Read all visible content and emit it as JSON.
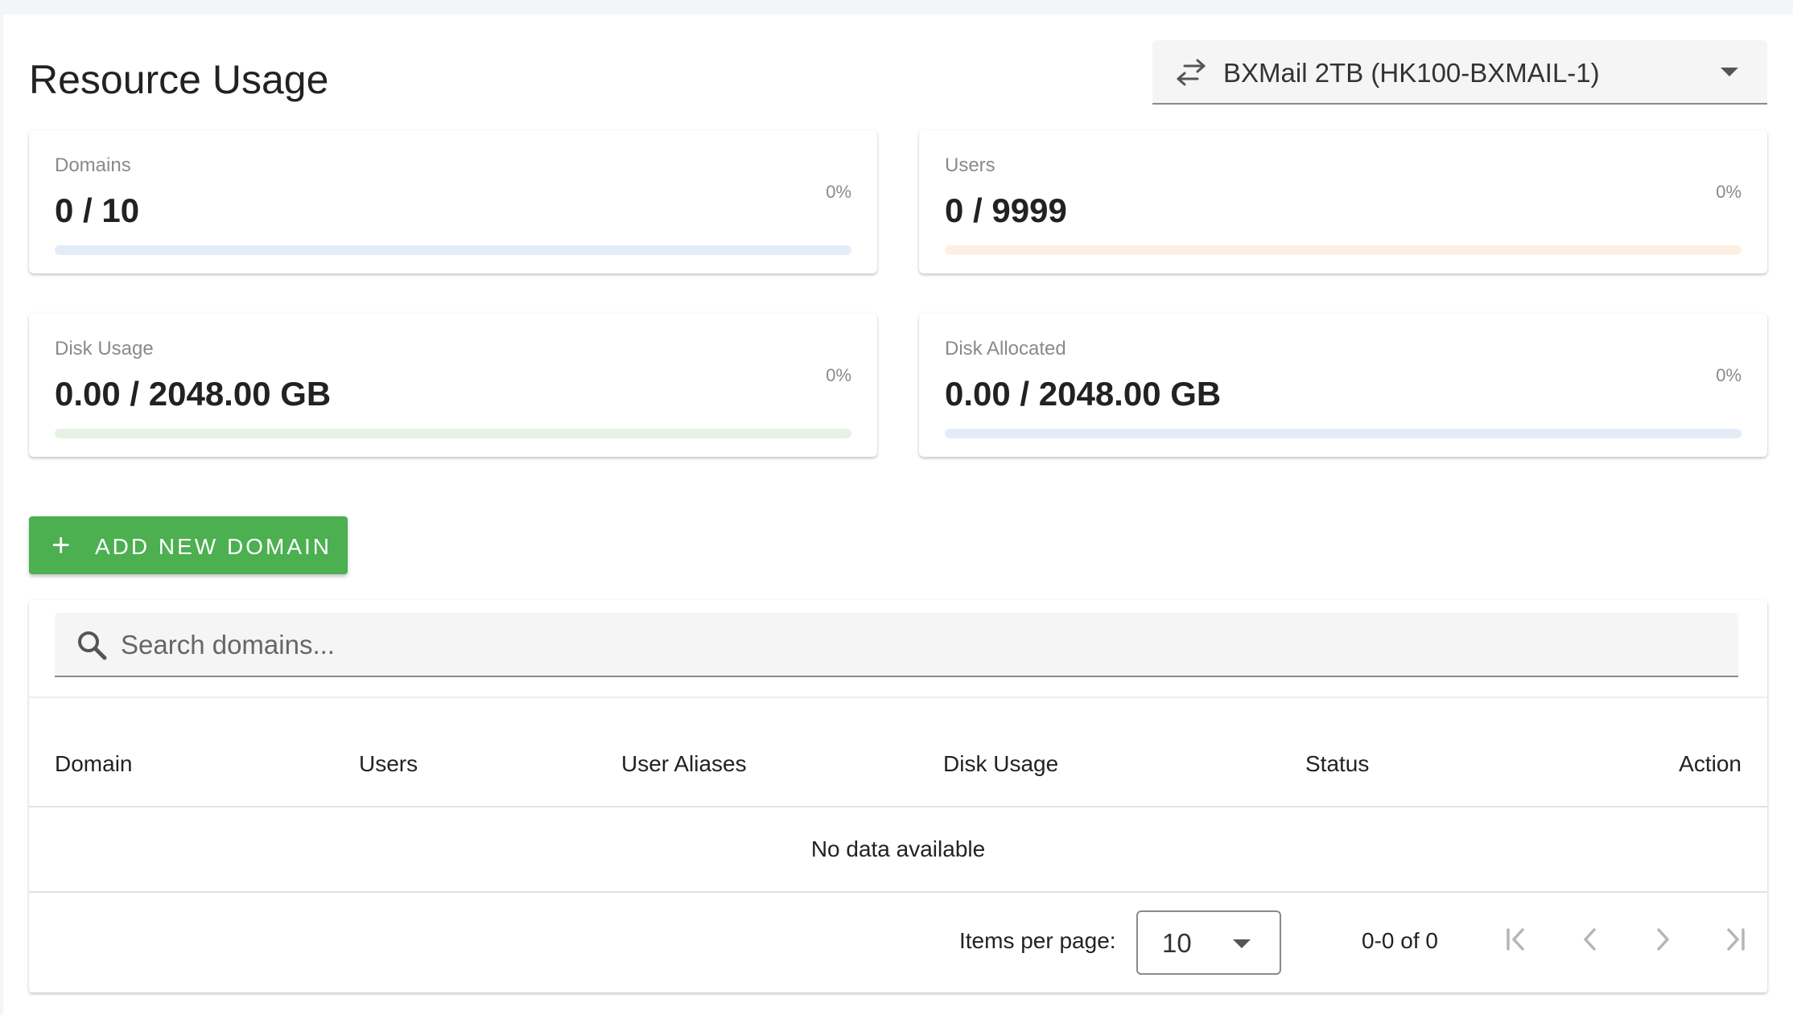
{
  "page": {
    "title": "Resource Usage"
  },
  "server_select": {
    "icon": "swap-horizontal-icon",
    "selected": "BXMail 2TB (HK100-BXMAIL-1)"
  },
  "usage_cards": {
    "domains": {
      "label": "Domains",
      "value": "0 / 10",
      "percent_label": "0%",
      "percent": 0,
      "track_color": "#e3ecf7"
    },
    "users": {
      "label": "Users",
      "value": "0 / 9999",
      "percent_label": "0%",
      "percent": 0,
      "track_color": "#fdefe2"
    },
    "disk_usage": {
      "label": "Disk Usage",
      "value": "0.00 / 2048.00 GB",
      "percent_label": "0%",
      "percent": 0,
      "track_color": "#e6f2e3"
    },
    "disk_allocated": {
      "label": "Disk Allocated",
      "value": "0.00 / 2048.00 GB",
      "percent_label": "0%",
      "percent": 0,
      "track_color": "#e3ecf7"
    }
  },
  "actions": {
    "add_domain_label": "ADD NEW DOMAIN",
    "add_icon": "plus-icon",
    "accent": "#4caf50"
  },
  "table": {
    "search_placeholder": "Search domains...",
    "columns": [
      "Domain",
      "Users",
      "User Aliases",
      "Disk Usage",
      "Status",
      "Action"
    ],
    "empty_text": "No data available",
    "footer": {
      "items_per_page_label": "Items per page:",
      "items_per_page": "10",
      "range_text": "0-0 of 0"
    }
  }
}
